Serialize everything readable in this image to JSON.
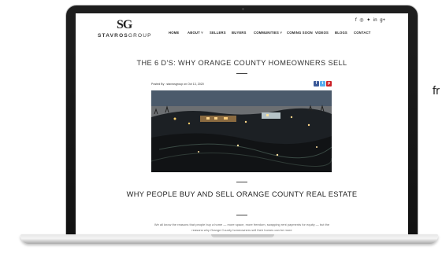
{
  "side_text": "fr",
  "site": {
    "logo_mark": "SG",
    "logo_word_bold": "STAVROS",
    "logo_word_light": "GROUP",
    "social_icons": [
      "facebook-icon",
      "instagram-icon",
      "twitter-icon",
      "linkedin-icon",
      "google-plus-icon"
    ],
    "social_glyphs": "f ◎ ✦ in g+",
    "nav": [
      "HOME",
      "ABOUT ˅",
      "SELLERS",
      "BUYERS",
      "COMMUNITIES ˅",
      "COMING SOON",
      "VIDEOS",
      "BLOGS",
      "CONTACT"
    ]
  },
  "post": {
    "title": "THE 6 D'S: WHY ORANGE COUNTY HOMEOWNERS SELL",
    "posted_by": "Posted By : stavrosgroup on Oct 13, 2020",
    "share_buttons": [
      {
        "name": "facebook-share-button",
        "glyph": "f",
        "color": "#3b5998"
      },
      {
        "name": "twitter-share-button",
        "glyph": "t",
        "color": "#55acee"
      },
      {
        "name": "pinterest-share-button",
        "glyph": "p",
        "color": "#cb2027"
      }
    ],
    "section_heading": "WHY PEOPLE BUY AND SELL ORANGE COUNTY REAL ESTATE",
    "body_text": "We all know the reasons that people buy a home — more space, more freedom, swapping rent payments for equity — but the reasons why Orange County homeowners sell their homes can be more"
  }
}
